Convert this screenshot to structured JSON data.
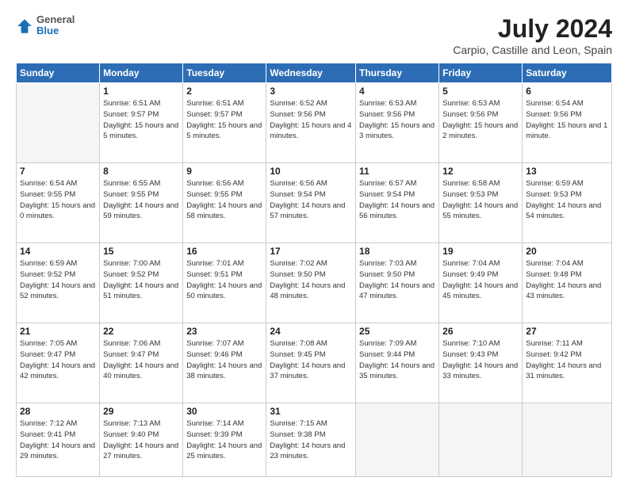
{
  "header": {
    "logo": {
      "general": "General",
      "blue": "Blue"
    },
    "title": "July 2024",
    "location": "Carpio, Castille and Leon, Spain"
  },
  "days_of_week": [
    "Sunday",
    "Monday",
    "Tuesday",
    "Wednesday",
    "Thursday",
    "Friday",
    "Saturday"
  ],
  "weeks": [
    [
      {
        "date": "",
        "info": ""
      },
      {
        "date": "1",
        "sunrise": "Sunrise: 6:51 AM",
        "sunset": "Sunset: 9:57 PM",
        "daylight": "Daylight: 15 hours and 5 minutes."
      },
      {
        "date": "2",
        "sunrise": "Sunrise: 6:51 AM",
        "sunset": "Sunset: 9:57 PM",
        "daylight": "Daylight: 15 hours and 5 minutes."
      },
      {
        "date": "3",
        "sunrise": "Sunrise: 6:52 AM",
        "sunset": "Sunset: 9:56 PM",
        "daylight": "Daylight: 15 hours and 4 minutes."
      },
      {
        "date": "4",
        "sunrise": "Sunrise: 6:53 AM",
        "sunset": "Sunset: 9:56 PM",
        "daylight": "Daylight: 15 hours and 3 minutes."
      },
      {
        "date": "5",
        "sunrise": "Sunrise: 6:53 AM",
        "sunset": "Sunset: 9:56 PM",
        "daylight": "Daylight: 15 hours and 2 minutes."
      },
      {
        "date": "6",
        "sunrise": "Sunrise: 6:54 AM",
        "sunset": "Sunset: 9:56 PM",
        "daylight": "Daylight: 15 hours and 1 minute."
      }
    ],
    [
      {
        "date": "7",
        "sunrise": "Sunrise: 6:54 AM",
        "sunset": "Sunset: 9:55 PM",
        "daylight": "Daylight: 15 hours and 0 minutes."
      },
      {
        "date": "8",
        "sunrise": "Sunrise: 6:55 AM",
        "sunset": "Sunset: 9:55 PM",
        "daylight": "Daylight: 14 hours and 59 minutes."
      },
      {
        "date": "9",
        "sunrise": "Sunrise: 6:56 AM",
        "sunset": "Sunset: 9:55 PM",
        "daylight": "Daylight: 14 hours and 58 minutes."
      },
      {
        "date": "10",
        "sunrise": "Sunrise: 6:56 AM",
        "sunset": "Sunset: 9:54 PM",
        "daylight": "Daylight: 14 hours and 57 minutes."
      },
      {
        "date": "11",
        "sunrise": "Sunrise: 6:57 AM",
        "sunset": "Sunset: 9:54 PM",
        "daylight": "Daylight: 14 hours and 56 minutes."
      },
      {
        "date": "12",
        "sunrise": "Sunrise: 6:58 AM",
        "sunset": "Sunset: 9:53 PM",
        "daylight": "Daylight: 14 hours and 55 minutes."
      },
      {
        "date": "13",
        "sunrise": "Sunrise: 6:59 AM",
        "sunset": "Sunset: 9:53 PM",
        "daylight": "Daylight: 14 hours and 54 minutes."
      }
    ],
    [
      {
        "date": "14",
        "sunrise": "Sunrise: 6:59 AM",
        "sunset": "Sunset: 9:52 PM",
        "daylight": "Daylight: 14 hours and 52 minutes."
      },
      {
        "date": "15",
        "sunrise": "Sunrise: 7:00 AM",
        "sunset": "Sunset: 9:52 PM",
        "daylight": "Daylight: 14 hours and 51 minutes."
      },
      {
        "date": "16",
        "sunrise": "Sunrise: 7:01 AM",
        "sunset": "Sunset: 9:51 PM",
        "daylight": "Daylight: 14 hours and 50 minutes."
      },
      {
        "date": "17",
        "sunrise": "Sunrise: 7:02 AM",
        "sunset": "Sunset: 9:50 PM",
        "daylight": "Daylight: 14 hours and 48 minutes."
      },
      {
        "date": "18",
        "sunrise": "Sunrise: 7:03 AM",
        "sunset": "Sunset: 9:50 PM",
        "daylight": "Daylight: 14 hours and 47 minutes."
      },
      {
        "date": "19",
        "sunrise": "Sunrise: 7:04 AM",
        "sunset": "Sunset: 9:49 PM",
        "daylight": "Daylight: 14 hours and 45 minutes."
      },
      {
        "date": "20",
        "sunrise": "Sunrise: 7:04 AM",
        "sunset": "Sunset: 9:48 PM",
        "daylight": "Daylight: 14 hours and 43 minutes."
      }
    ],
    [
      {
        "date": "21",
        "sunrise": "Sunrise: 7:05 AM",
        "sunset": "Sunset: 9:47 PM",
        "daylight": "Daylight: 14 hours and 42 minutes."
      },
      {
        "date": "22",
        "sunrise": "Sunrise: 7:06 AM",
        "sunset": "Sunset: 9:47 PM",
        "daylight": "Daylight: 14 hours and 40 minutes."
      },
      {
        "date": "23",
        "sunrise": "Sunrise: 7:07 AM",
        "sunset": "Sunset: 9:46 PM",
        "daylight": "Daylight: 14 hours and 38 minutes."
      },
      {
        "date": "24",
        "sunrise": "Sunrise: 7:08 AM",
        "sunset": "Sunset: 9:45 PM",
        "daylight": "Daylight: 14 hours and 37 minutes."
      },
      {
        "date": "25",
        "sunrise": "Sunrise: 7:09 AM",
        "sunset": "Sunset: 9:44 PM",
        "daylight": "Daylight: 14 hours and 35 minutes."
      },
      {
        "date": "26",
        "sunrise": "Sunrise: 7:10 AM",
        "sunset": "Sunset: 9:43 PM",
        "daylight": "Daylight: 14 hours and 33 minutes."
      },
      {
        "date": "27",
        "sunrise": "Sunrise: 7:11 AM",
        "sunset": "Sunset: 9:42 PM",
        "daylight": "Daylight: 14 hours and 31 minutes."
      }
    ],
    [
      {
        "date": "28",
        "sunrise": "Sunrise: 7:12 AM",
        "sunset": "Sunset: 9:41 PM",
        "daylight": "Daylight: 14 hours and 29 minutes."
      },
      {
        "date": "29",
        "sunrise": "Sunrise: 7:13 AM",
        "sunset": "Sunset: 9:40 PM",
        "daylight": "Daylight: 14 hours and 27 minutes."
      },
      {
        "date": "30",
        "sunrise": "Sunrise: 7:14 AM",
        "sunset": "Sunset: 9:39 PM",
        "daylight": "Daylight: 14 hours and 25 minutes."
      },
      {
        "date": "31",
        "sunrise": "Sunrise: 7:15 AM",
        "sunset": "Sunset: 9:38 PM",
        "daylight": "Daylight: 14 hours and 23 minutes."
      },
      {
        "date": "",
        "info": ""
      },
      {
        "date": "",
        "info": ""
      },
      {
        "date": "",
        "info": ""
      }
    ]
  ]
}
